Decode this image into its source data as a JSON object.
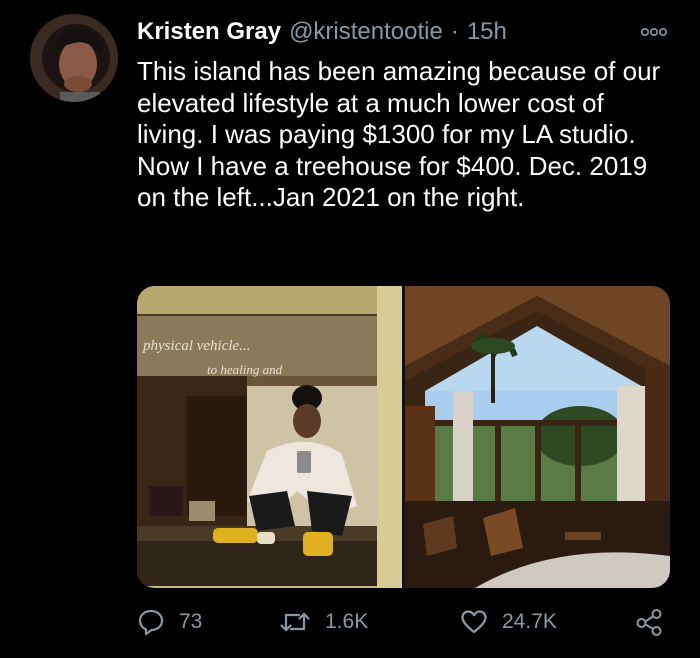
{
  "tweet": {
    "author_name": "Kristen Gray",
    "handle": "@kristentootie",
    "separator": "·",
    "time": "15h",
    "text": "This island has been amazing because of our elevated lifestyle at a much lower cost of living. I was paying $1300 for my LA studio. Now I have a treehouse for $400. Dec. 2019 on the left...Jan 2021 on the right.",
    "media": {
      "left_photo_caption_line1": "physical vehicle...",
      "left_photo_caption_line2": "to healing and"
    },
    "counts": {
      "replies": "73",
      "retweets": "1.6K",
      "likes": "24.7K"
    }
  },
  "colors": {
    "background": "#000000",
    "primary_text": "#ffffff",
    "secondary_text": "#8899a6"
  },
  "icons": {
    "more": "more-horizontal-icon",
    "reply": "reply-bubble-icon",
    "retweet": "retweet-arrows-icon",
    "like": "heart-outline-icon",
    "share": "share-nodes-icon"
  }
}
